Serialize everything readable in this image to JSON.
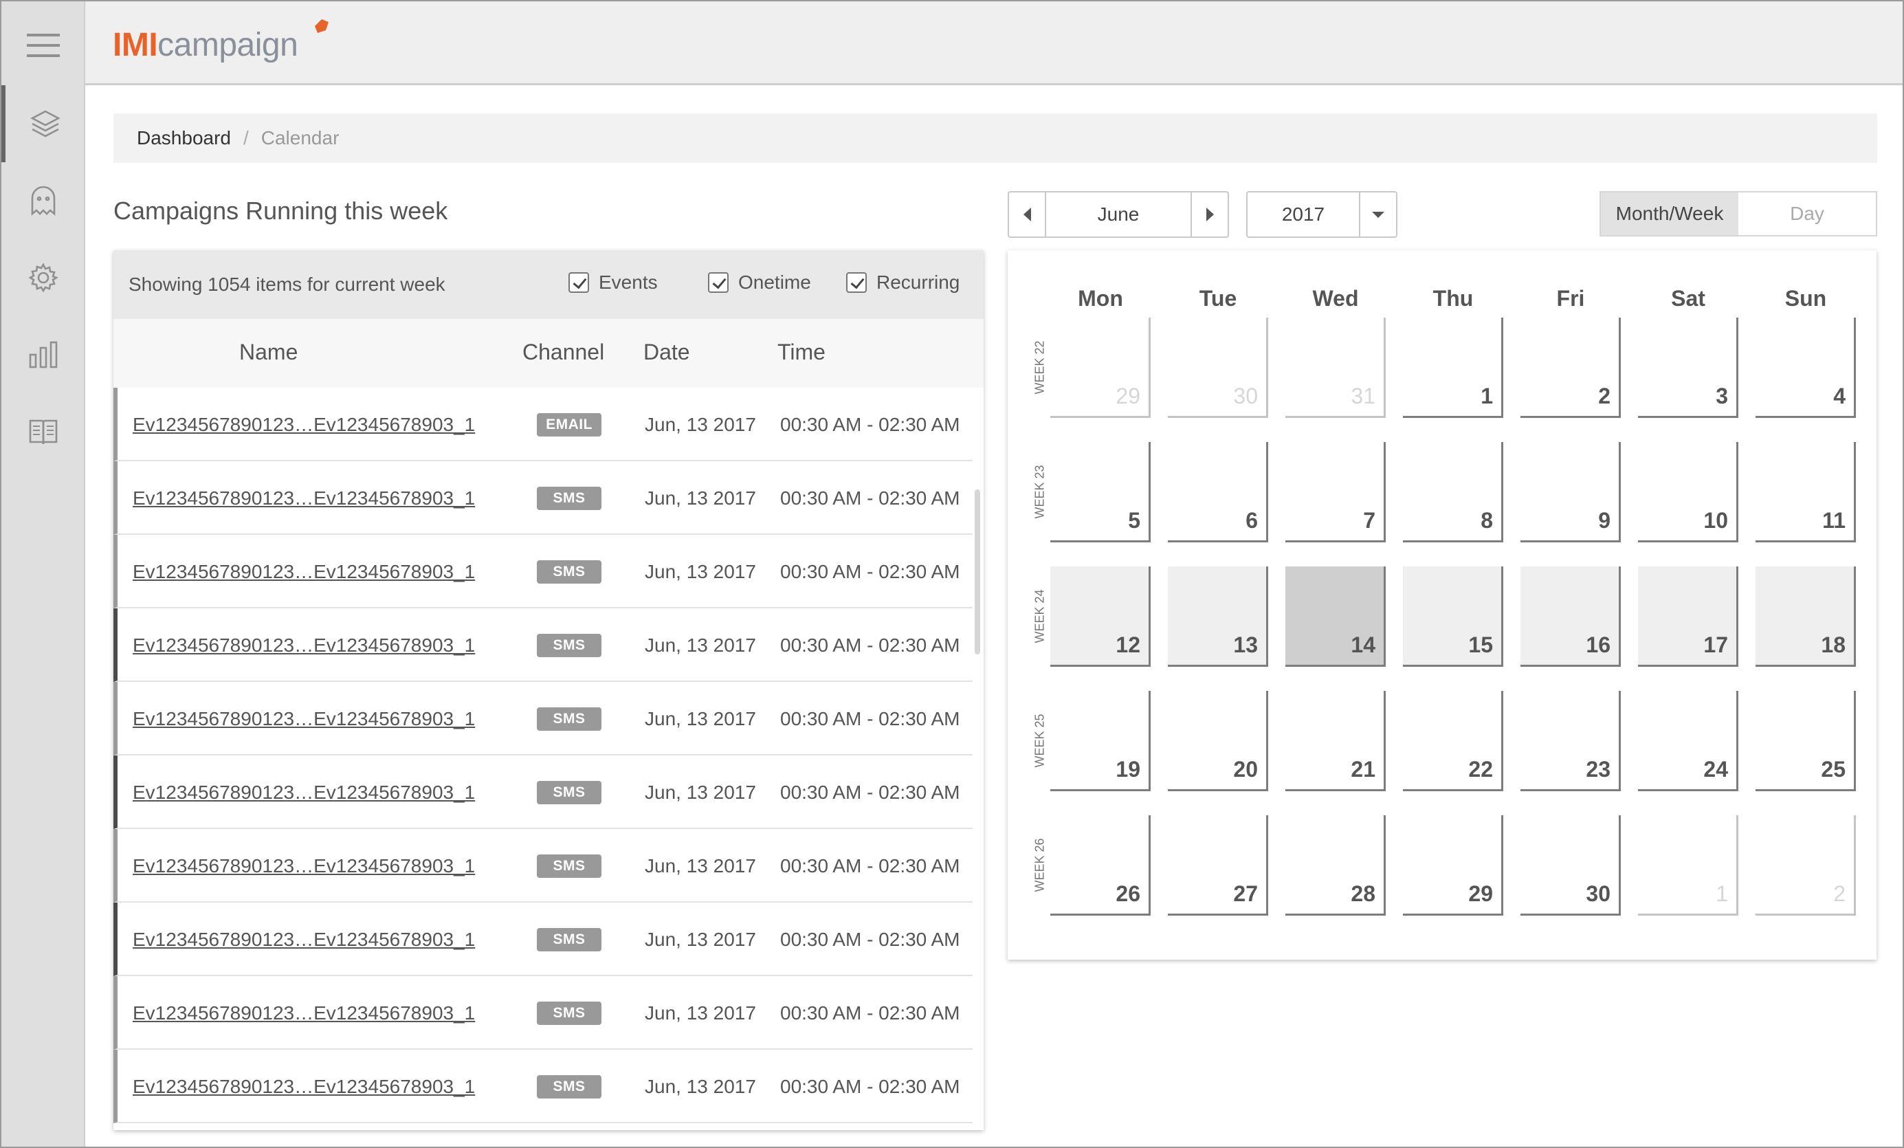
{
  "app": {
    "logo_primary": "IMI",
    "logo_secondary": "campaign"
  },
  "sidebar": {
    "items": [
      {
        "icon": "menu-icon"
      },
      {
        "icon": "layers-icon",
        "active": true
      },
      {
        "icon": "ghost-icon"
      },
      {
        "icon": "gear-icon"
      },
      {
        "icon": "bar-chart-icon"
      },
      {
        "icon": "book-icon"
      }
    ]
  },
  "breadcrumb": {
    "home": "Dashboard",
    "separator": "/",
    "current": "Calendar"
  },
  "section": {
    "title": "Campaigns Running this week"
  },
  "filters": {
    "count_text": "Showing 1054 items for current week",
    "options": [
      {
        "label": "Events",
        "checked": true
      },
      {
        "label": "Onetime",
        "checked": true
      },
      {
        "label": "Recurring",
        "checked": true
      }
    ]
  },
  "table": {
    "headers": {
      "name": "Name",
      "channel": "Channel",
      "date": "Date",
      "time": "Time"
    },
    "rows": [
      {
        "name": "Ev1234567890123…Ev12345678903_1",
        "channel": "EMAIL",
        "date": "Jun, 13 2017",
        "time": "00:30 AM - 02:30 AM",
        "accent": "light"
      },
      {
        "name": "Ev1234567890123…Ev12345678903_1",
        "channel": "SMS",
        "date": "Jun, 13 2017",
        "time": "00:30 AM - 02:30 AM",
        "accent": "light"
      },
      {
        "name": "Ev1234567890123…Ev12345678903_1",
        "channel": "SMS",
        "date": "Jun, 13 2017",
        "time": "00:30 AM - 02:30 AM",
        "accent": "light"
      },
      {
        "name": "Ev1234567890123…Ev12345678903_1",
        "channel": "SMS",
        "date": "Jun, 13 2017",
        "time": "00:30 AM - 02:30 AM",
        "accent": "dark"
      },
      {
        "name": "Ev1234567890123…Ev12345678903_1",
        "channel": "SMS",
        "date": "Jun, 13 2017",
        "time": "00:30 AM - 02:30 AM",
        "accent": "light"
      },
      {
        "name": "Ev1234567890123…Ev12345678903_1",
        "channel": "SMS",
        "date": "Jun, 13 2017",
        "time": "00:30 AM - 02:30 AM",
        "accent": "dark"
      },
      {
        "name": "Ev1234567890123…Ev12345678903_1",
        "channel": "SMS",
        "date": "Jun, 13 2017",
        "time": "00:30 AM - 02:30 AM",
        "accent": "light"
      },
      {
        "name": "Ev1234567890123…Ev12345678903_1",
        "channel": "SMS",
        "date": "Jun, 13 2017",
        "time": "00:30 AM - 02:30 AM",
        "accent": "dark"
      },
      {
        "name": "Ev1234567890123…Ev12345678903_1",
        "channel": "SMS",
        "date": "Jun, 13 2017",
        "time": "00:30 AM - 02:30 AM",
        "accent": "light"
      },
      {
        "name": "Ev1234567890123…Ev12345678903_1",
        "channel": "SMS",
        "date": "Jun, 13 2017",
        "time": "00:30 AM - 02:30 AM",
        "accent": "light"
      }
    ]
  },
  "calendar_controls": {
    "month": "June",
    "year": "2017",
    "views": [
      "Month/Week",
      "Day"
    ],
    "active_view": "Month/Week"
  },
  "calendar": {
    "days_of_week": [
      "Mon",
      "Tue",
      "Wed",
      "Thu",
      "Fri",
      "Sat",
      "Sun"
    ],
    "weeks": [
      {
        "label": "WEEK 22",
        "days": [
          {
            "n": "29",
            "type": "other"
          },
          {
            "n": "30",
            "type": "other"
          },
          {
            "n": "31",
            "type": "other"
          },
          {
            "n": "1",
            "type": "normal"
          },
          {
            "n": "2",
            "type": "normal"
          },
          {
            "n": "3",
            "type": "normal"
          },
          {
            "n": "4",
            "type": "normal"
          }
        ]
      },
      {
        "label": "WEEK 23",
        "days": [
          {
            "n": "5",
            "type": "normal"
          },
          {
            "n": "6",
            "type": "normal"
          },
          {
            "n": "7",
            "type": "normal"
          },
          {
            "n": "8",
            "type": "normal"
          },
          {
            "n": "9",
            "type": "normal"
          },
          {
            "n": "10",
            "type": "normal"
          },
          {
            "n": "11",
            "type": "normal"
          }
        ]
      },
      {
        "label": "WEEK 24",
        "days": [
          {
            "n": "12",
            "type": "cur"
          },
          {
            "n": "13",
            "type": "cur"
          },
          {
            "n": "14",
            "type": "today"
          },
          {
            "n": "15",
            "type": "cur"
          },
          {
            "n": "16",
            "type": "cur"
          },
          {
            "n": "17",
            "type": "cur"
          },
          {
            "n": "18",
            "type": "cur"
          }
        ]
      },
      {
        "label": "WEEK 25",
        "days": [
          {
            "n": "19",
            "type": "normal"
          },
          {
            "n": "20",
            "type": "normal"
          },
          {
            "n": "21",
            "type": "normal"
          },
          {
            "n": "22",
            "type": "normal"
          },
          {
            "n": "23",
            "type": "normal"
          },
          {
            "n": "24",
            "type": "normal"
          },
          {
            "n": "25",
            "type": "normal"
          }
        ]
      },
      {
        "label": "WEEK 26",
        "days": [
          {
            "n": "26",
            "type": "normal"
          },
          {
            "n": "27",
            "type": "normal"
          },
          {
            "n": "28",
            "type": "normal"
          },
          {
            "n": "29",
            "type": "normal"
          },
          {
            "n": "30",
            "type": "normal"
          },
          {
            "n": "1",
            "type": "other"
          },
          {
            "n": "2",
            "type": "other"
          }
        ]
      }
    ]
  },
  "colors": {
    "brand_orange": "#e8632a",
    "brand_gray": "#8a9099",
    "sidebar_bg": "#dfdfdf",
    "today_bg": "#cfcfcf",
    "current_week_bg": "#efefef"
  }
}
